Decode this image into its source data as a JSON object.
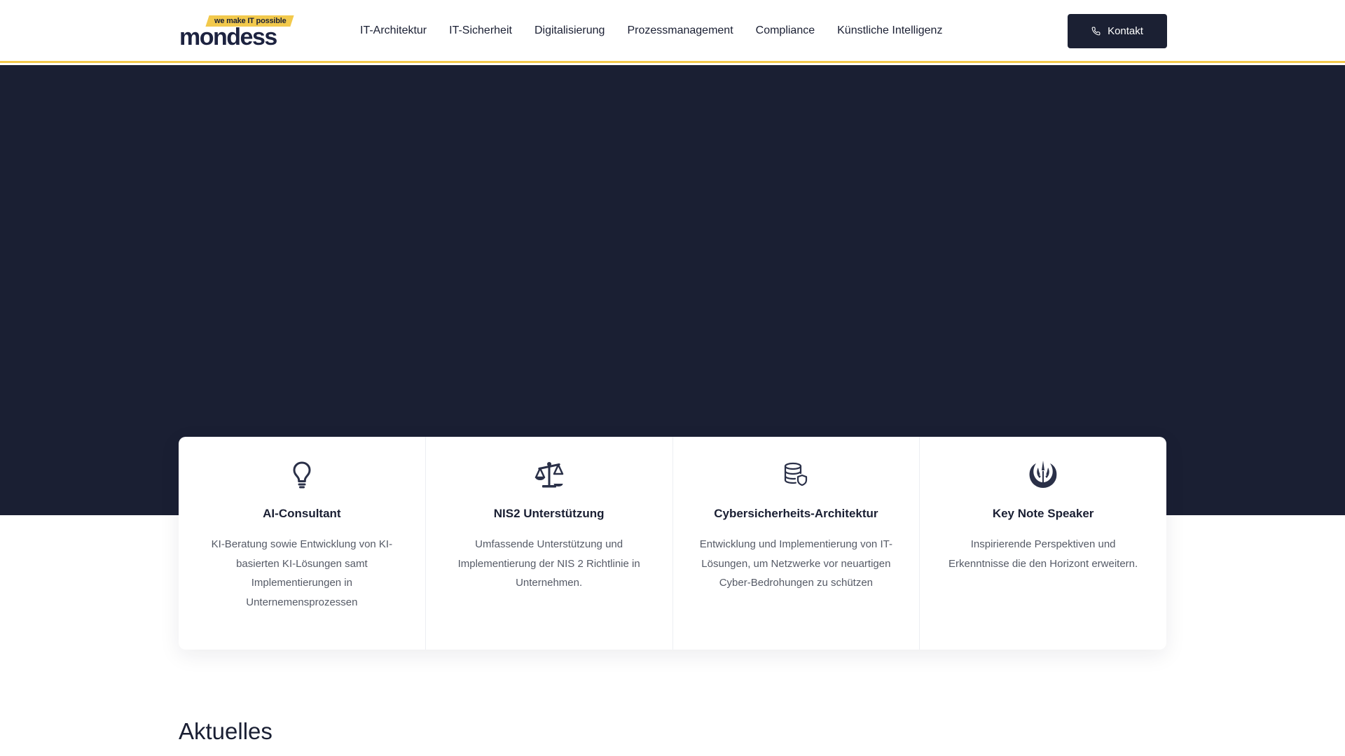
{
  "brand": {
    "tagline": "we make IT possible",
    "name": "mondess",
    "accent_color": "#f2c94c",
    "dark_color": "#1a1f33"
  },
  "nav": {
    "items": [
      {
        "label": "IT-Architektur"
      },
      {
        "label": "IT-Sicherheit"
      },
      {
        "label": "Digitalisierung"
      },
      {
        "label": "Prozessmanagement"
      },
      {
        "label": "Compliance"
      },
      {
        "label": "Künstliche Intelligenz"
      }
    ],
    "contact": {
      "label": "Kontakt",
      "icon": "phone-icon"
    }
  },
  "services": [
    {
      "icon": "lightbulb-icon",
      "title": "AI-Consultant",
      "text": "KI-Beratung sowie Entwicklung von KI-basierten KI-Lösungen samt Implementierungen in Unternemensprozessen"
    },
    {
      "icon": "balance-scale-icon",
      "title": "NIS2 Unterstützung",
      "text": "Umfassende Unterstützung und Implementierung der NIS 2 Richtlinie in Unternehmen."
    },
    {
      "icon": "database-shield-icon",
      "title": "Cybersicherheits-Architektur",
      "text": "Entwicklung und Implementierung von IT-Lösungen, um Netzwerke vor neuartigen Cyber-Bedrohungen zu schützen"
    },
    {
      "icon": "speaker-emblem-icon",
      "title": "Key Note Speaker",
      "text": "Inspirierende Perspektiven und Erkenntnisse die den Horizont erweitern."
    }
  ],
  "sections": {
    "news_title": "Aktuelles"
  }
}
